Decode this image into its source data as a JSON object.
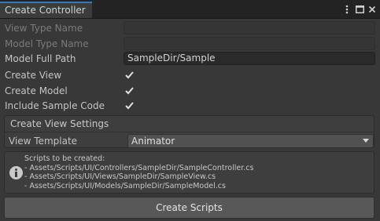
{
  "window": {
    "tab_title": "Create Controller",
    "actions": {
      "more_icon": "more-vertical",
      "maximize_icon": "maximize",
      "close_icon": "close"
    }
  },
  "form": {
    "view_type_name": {
      "label": "View Type Name",
      "value": ""
    },
    "model_type_name": {
      "label": "Model Type Name",
      "value": ""
    },
    "model_full_path": {
      "label": "Model Full Path",
      "value": "SampleDir/Sample"
    },
    "create_view": {
      "label": "Create View",
      "checked": true
    },
    "create_model": {
      "label": "Create Model",
      "checked": true
    },
    "include_sample_code": {
      "label": "Include Sample Code",
      "checked": true
    }
  },
  "view_settings": {
    "title": "Create View Settings",
    "view_template": {
      "label": "View Template",
      "selected": "Animator"
    }
  },
  "help": {
    "icon": "info",
    "lines": [
      "Scripts to be created:",
      "- Assets/Scripts/UI/Controllers/SampleDir/SampleController.cs",
      "- Assets/Scripts/UI/Views/SampleDir/SampleView.cs",
      "- Assets/Scripts/UI/Models/SampleDir/SampleModel.cs"
    ]
  },
  "actions": {
    "create_scripts_label": "Create Scripts"
  },
  "colors": {
    "background": "#383838",
    "tab_accent": "#3a79bb",
    "field": "#2a2a2a",
    "button": "#585858"
  }
}
